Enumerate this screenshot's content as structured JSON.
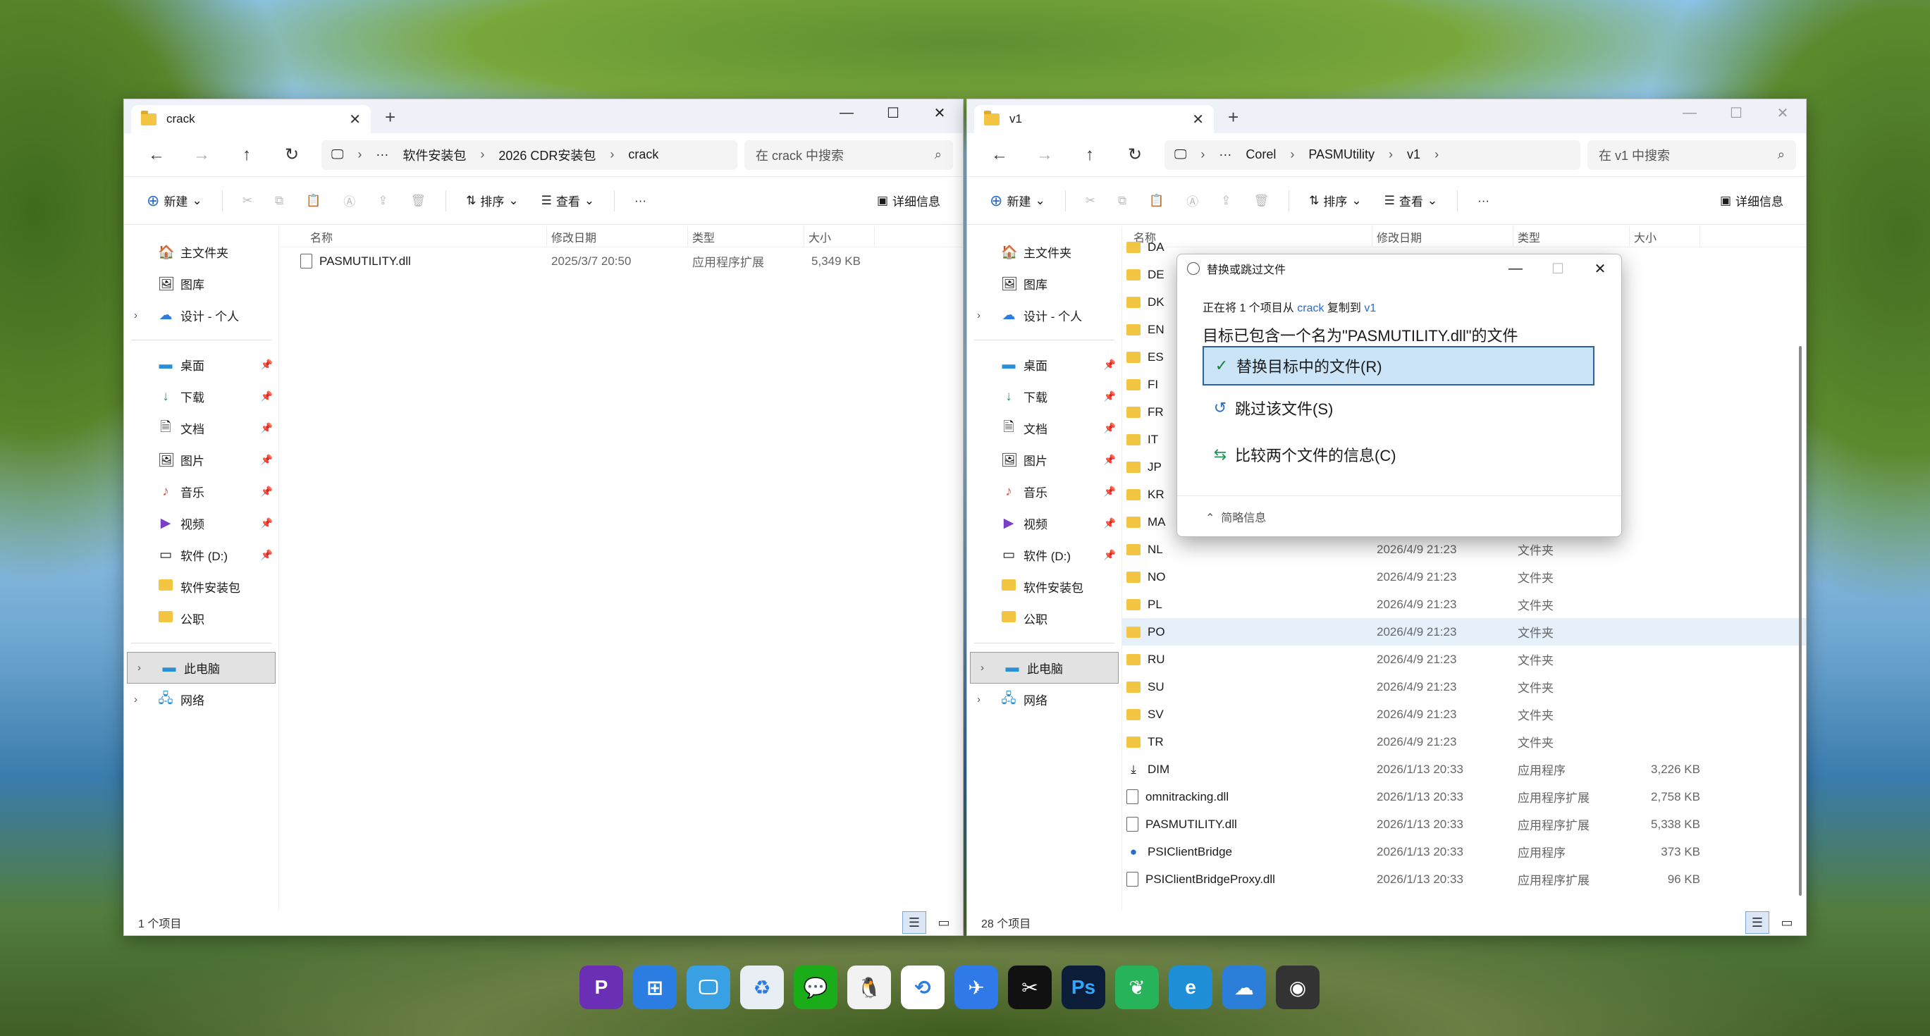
{
  "left_window": {
    "tab_title": "crack",
    "breadcrumb": [
      "软件安装包",
      "2026 CDR安装包",
      "crack"
    ],
    "search_placeholder": "在 crack 中搜索",
    "toolbar": {
      "new": "新建",
      "sort": "排序",
      "view": "查看",
      "more": "···",
      "details": "详细信息"
    },
    "columns": [
      "名称",
      "修改日期",
      "类型",
      "大小"
    ],
    "files": [
      {
        "name": "PASMUTILITY.dll",
        "date": "2025/3/7 20:50",
        "type": "应用程序扩展",
        "size": "5,349 KB"
      }
    ],
    "status": "1 个项目"
  },
  "right_window": {
    "tab_title": "v1",
    "breadcrumb": [
      "Corel",
      "PASMUtility",
      "v1"
    ],
    "search_placeholder": "在 v1 中搜索",
    "toolbar": {
      "new": "新建",
      "sort": "排序",
      "view": "查看",
      "more": "···",
      "details": "详细信息"
    },
    "columns": [
      "名称",
      "修改日期",
      "类型",
      "大小"
    ],
    "folders_top": [
      "DA",
      "DE",
      "DK",
      "EN",
      "ES",
      "FI",
      "FR",
      "IT",
      "JP",
      "KR",
      "MA"
    ],
    "rows": [
      {
        "name": "NL",
        "date": "2026/4/9 21:23",
        "type": "文件夹",
        "size": "",
        "kind": "folder"
      },
      {
        "name": "NO",
        "date": "2026/4/9 21:23",
        "type": "文件夹",
        "size": "",
        "kind": "folder"
      },
      {
        "name": "PL",
        "date": "2026/4/9 21:23",
        "type": "文件夹",
        "size": "",
        "kind": "folder"
      },
      {
        "name": "PO",
        "date": "2026/4/9 21:23",
        "type": "文件夹",
        "size": "",
        "kind": "folder",
        "hl": true
      },
      {
        "name": "RU",
        "date": "2026/4/9 21:23",
        "type": "文件夹",
        "size": "",
        "kind": "folder"
      },
      {
        "name": "SU",
        "date": "2026/4/9 21:23",
        "type": "文件夹",
        "size": "",
        "kind": "folder"
      },
      {
        "name": "SV",
        "date": "2026/4/9 21:23",
        "type": "文件夹",
        "size": "",
        "kind": "folder"
      },
      {
        "name": "TR",
        "date": "2026/4/9 21:23",
        "type": "文件夹",
        "size": "",
        "kind": "folder"
      },
      {
        "name": "DIM",
        "date": "2026/1/13 20:33",
        "type": "应用程序",
        "size": "3,226 KB",
        "kind": "app"
      },
      {
        "name": "omnitracking.dll",
        "date": "2026/1/13 20:33",
        "type": "应用程序扩展",
        "size": "2,758 KB",
        "kind": "doc"
      },
      {
        "name": "PASMUTILITY.dll",
        "date": "2026/1/13 20:33",
        "type": "应用程序扩展",
        "size": "5,338 KB",
        "kind": "doc"
      },
      {
        "name": "PSIClientBridge",
        "date": "2026/1/13 20:33",
        "type": "应用程序",
        "size": "373 KB",
        "kind": "app2"
      },
      {
        "name": "PSIClientBridgeProxy.dll",
        "date": "2026/1/13 20:33",
        "type": "应用程序扩展",
        "size": "96 KB",
        "kind": "doc"
      }
    ],
    "status": "28 个项目"
  },
  "sidebar": {
    "home": "主文件夹",
    "gallery": "图库",
    "cloud": "设计 - 个人",
    "desktop": "桌面",
    "downloads": "下载",
    "documents": "文档",
    "pictures": "图片",
    "music": "音乐",
    "videos": "视频",
    "drive": "软件 (D:)",
    "pkg": "软件安装包",
    "job": "公职",
    "pc": "此电脑",
    "network": "网络"
  },
  "dialog": {
    "title": "替换或跳过文件",
    "copy_prefix": "正在将 1 个项目从 ",
    "copy_src": "crack",
    "copy_mid": " 复制到 ",
    "copy_dst": "v1",
    "message": "目标已包含一个名为\"PASMUTILITY.dll\"的文件",
    "opt_replace": "替换目标中的文件(R)",
    "opt_skip": "跳过该文件(S)",
    "opt_compare": "比较两个文件的信息(C)",
    "less_info": "简略信息"
  },
  "taskbar": {
    "ps_label": "Ps"
  },
  "colors": {
    "accent": "#2c6cc7",
    "folder": "#f4c542",
    "selection": "#cce4f7"
  }
}
